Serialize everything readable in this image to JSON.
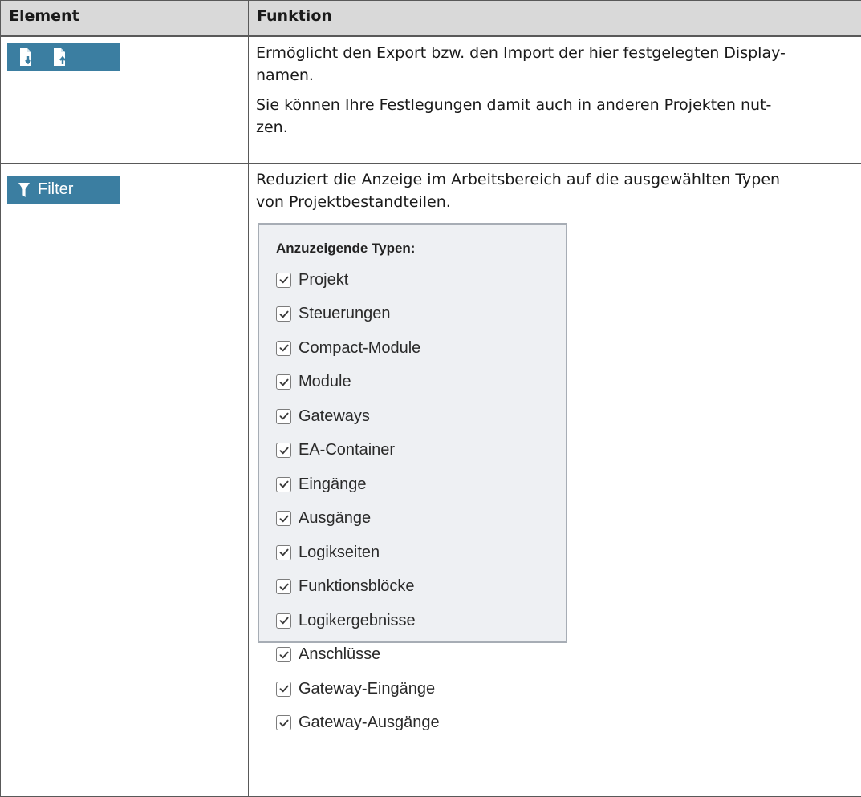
{
  "table": {
    "header_element": "Element",
    "header_funktion": "Funktion"
  },
  "rows": {
    "export_import": {
      "icons": [
        "export-icon",
        "import-icon"
      ],
      "paragraph1": "Ermöglicht den Export bzw. den Import der hier festgelegten Display-namen.",
      "paragraph1_line1": "Ermöglicht den Export bzw. den Import der hier festgelegten Display-",
      "paragraph1_line2": "namen.",
      "paragraph2_line1": "Sie können Ihre Festlegungen damit auch in anderen Projekten nut-",
      "paragraph2_line2": "zen."
    },
    "filter": {
      "button_label": "Filter",
      "button_icon": "funnel-icon",
      "description_line1": "Reduziert die Anzeige im Arbeitsbereich auf die ausgewählten Typen",
      "description_line2": "von Projektbestandteilen.",
      "panel_title": "Anzuzeigende Typen:",
      "options": [
        {
          "label": "Projekt",
          "checked": true
        },
        {
          "label": "Steuerungen",
          "checked": true
        },
        {
          "label": "Compact-Module",
          "checked": true
        },
        {
          "label": "Module",
          "checked": true
        },
        {
          "label": "Gateways",
          "checked": true
        },
        {
          "label": "EA-Container",
          "checked": true
        },
        {
          "label": "Eingänge",
          "checked": true
        },
        {
          "label": "Ausgänge",
          "checked": true
        },
        {
          "label": "Logikseiten",
          "checked": true
        },
        {
          "label": "Funktionsblöcke",
          "checked": true
        },
        {
          "label": "Logikergebnisse",
          "checked": true
        },
        {
          "label": "Anschlüsse",
          "checked": true
        },
        {
          "label": "Gateway-Eingänge",
          "checked": true
        },
        {
          "label": "Gateway-Ausgänge",
          "checked": true
        }
      ]
    }
  },
  "colors": {
    "button_bg": "#3b7ea1",
    "header_bg": "#d9d9d9",
    "panel_bg": "#eef0f3",
    "panel_border": "#a7adb5"
  }
}
